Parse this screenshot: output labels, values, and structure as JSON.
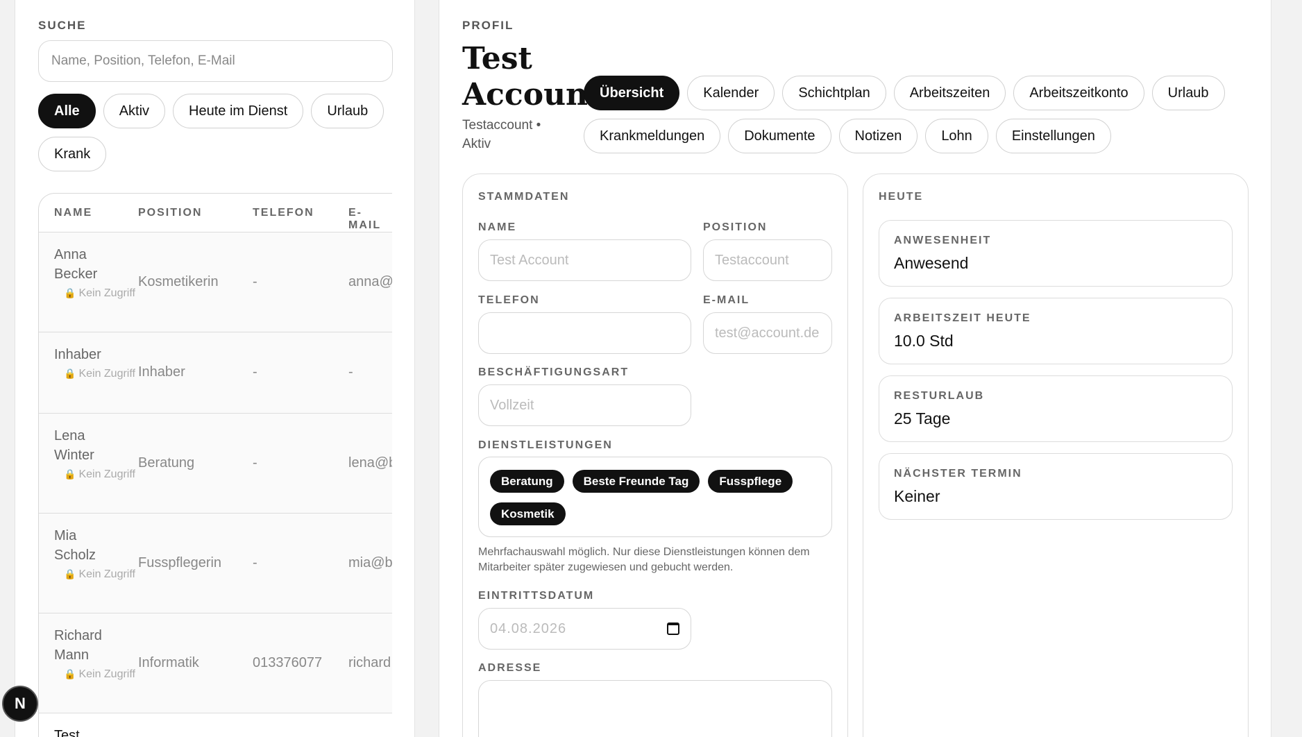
{
  "search": {
    "label": "SUCHE",
    "placeholder": "Name, Position, Telefon, E-Mail",
    "filters": [
      "Alle",
      "Aktiv",
      "Heute im Dienst",
      "Urlaub",
      "Krank"
    ]
  },
  "table": {
    "headers": [
      "NAME",
      "POSITION",
      "TELEFON",
      "E-MAIL"
    ],
    "no_access": "Kein Zugriff",
    "rows": [
      {
        "first": "Anna",
        "last": "Becker",
        "position": "Kosmetikerin",
        "phone": "-",
        "email": "anna@"
      },
      {
        "first": "Inhaber",
        "last": "",
        "position": "Inhaber",
        "phone": "-",
        "email": "-"
      },
      {
        "first": "Lena",
        "last": "Winter",
        "position": "Beratung",
        "phone": "-",
        "email": "lena@b"
      },
      {
        "first": "Mia",
        "last": "Scholz",
        "position": "Fusspflegerin",
        "phone": "-",
        "email": "mia@b"
      },
      {
        "first": "Richard",
        "last": "Mann",
        "position": "Informatik",
        "phone": "013376077",
        "email": "richard"
      },
      {
        "first": "Test",
        "last": "",
        "position": "",
        "phone": "",
        "email": ""
      }
    ]
  },
  "profile": {
    "label": "PROFIL",
    "title_line1": "Test",
    "title_line2": "Account",
    "subtitle": "Testaccount • Aktiv",
    "tabs": [
      "Übersicht",
      "Kalender",
      "Schichtplan",
      "Arbeitszeiten",
      "Arbeitszeitkonto",
      "Urlaub",
      "Krankmeldungen",
      "Dokumente",
      "Notizen",
      "Lohn",
      "Einstellungen"
    ]
  },
  "stammdaten": {
    "title": "STAMMDATEN",
    "name_label": "NAME",
    "name_value": "Test Account",
    "position_label": "POSITION",
    "position_value": "Testaccount",
    "phone_label": "TELEFON",
    "phone_value": "",
    "email_label": "E-MAIL",
    "email_value": "test@account.de",
    "employment_label": "BESCHÄFTIGUNGSART",
    "employment_value": "Vollzeit",
    "services_label": "DIENSTLEISTUNGEN",
    "services": [
      "Beratung",
      "Beste Freunde Tag",
      "Fusspflege",
      "Kosmetik"
    ],
    "services_hint": "Mehrfachauswahl möglich. Nur diese Dienstleistungen können dem Mitarbeiter später zugewiesen und gebucht werden.",
    "entry_label": "EINTRITTSDATUM",
    "entry_value": "04.08.2026",
    "address_label": "ADRESSE",
    "address_value": ""
  },
  "heute": {
    "title": "HEUTE",
    "stats": [
      {
        "label": "ANWESENHEIT",
        "value": "Anwesend"
      },
      {
        "label": "ARBEITSZEIT HEUTE",
        "value": "10.0 Std"
      },
      {
        "label": "RESTURLAUB",
        "value": "25 Tage"
      },
      {
        "label": "NÄCHSTER TERMIN",
        "value": "Keiner"
      }
    ]
  },
  "fab": {
    "label": "N"
  }
}
